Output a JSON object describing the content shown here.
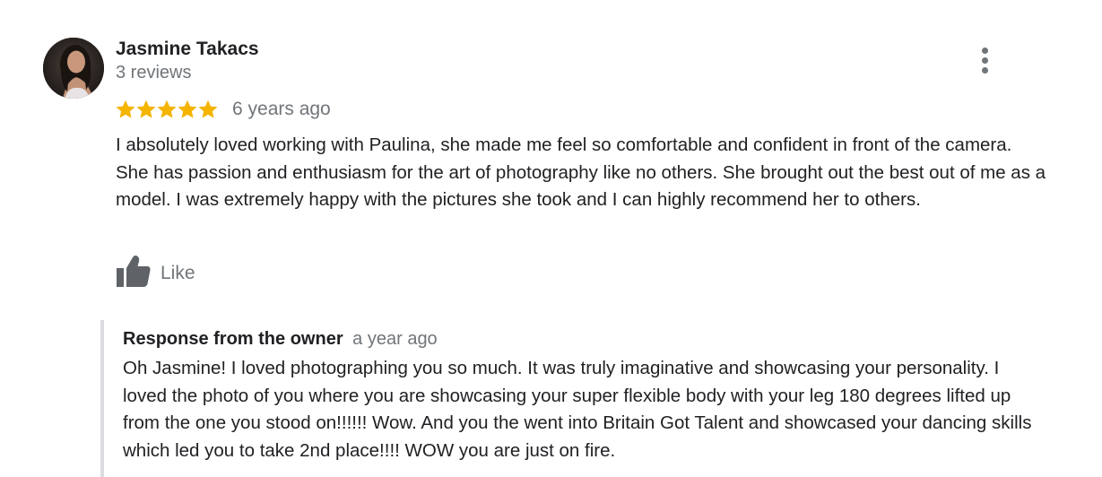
{
  "review": {
    "reviewer_name": "Jasmine Takacs",
    "review_count": "3 reviews",
    "rating": 5,
    "max_rating": 5,
    "time_ago": "6 years ago",
    "text": "I absolutely loved working with Paulina, she made me feel so comfortable and confident in front of the camera. She has passion and enthusiasm for the art of photography like no others. She brought out the best out of me as a model. I was extremely happy with the pictures she took and I can highly recommend her to others.",
    "like_label": "Like",
    "icons": {
      "avatar": "avatar",
      "more": "more-vert-icon",
      "star": "star-icon",
      "like": "thumb-up-icon"
    }
  },
  "owner_response": {
    "title": "Response from the owner",
    "time_ago": "a year ago",
    "text": "Oh Jasmine! I loved photographing you so much. It was truly imaginative and showcasing your personality. I loved the photo of you where you are showcasing your super flexible body with your leg 180 degrees lifted up from the one you stood on!!!!!! Wow. And you the went into Britain Got Talent and showcased your dancing skills which led you to take 2nd place!!!! WOW you are just on fire."
  },
  "colors": {
    "star": "#f4b400",
    "secondary_text": "#70757a",
    "primary_text": "#202124",
    "response_border": "#dadce0"
  }
}
